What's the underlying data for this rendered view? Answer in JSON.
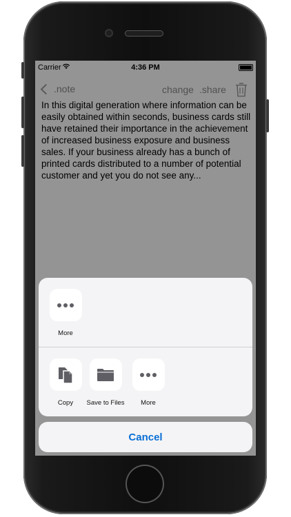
{
  "status_bar": {
    "carrier": "Carrier",
    "time": "4:36 PM"
  },
  "nav_bar": {
    "back_label": ".note",
    "change_label": "change",
    "share_label": ".share"
  },
  "note": {
    "text": "In this digital generation where information can be easily obtained within seconds, business cards still have retained their importance in the achievement of increased business exposure and business sales. If your business already has a bunch of printed cards distributed to a number of potential customer and yet you do not see any..."
  },
  "share_sheet": {
    "app_row": [
      {
        "label": "More",
        "icon": "more-icon"
      }
    ],
    "action_row": [
      {
        "label": "Copy",
        "icon": "copy-icon"
      },
      {
        "label": "Save to Files",
        "icon": "folder-icon"
      },
      {
        "label": "More",
        "icon": "more-icon"
      }
    ],
    "cancel_label": "Cancel"
  },
  "colors": {
    "accent": "#0a6fd6",
    "sheet_bg": "#f4f4f6",
    "icon_gray": "#5e5e64"
  }
}
